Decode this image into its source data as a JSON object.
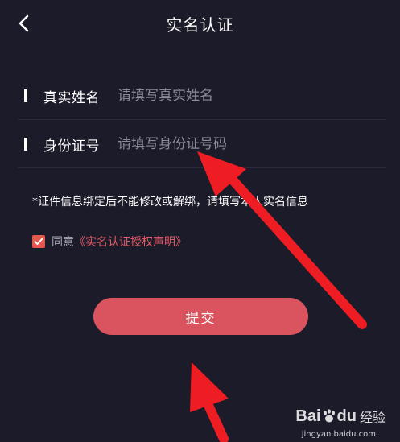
{
  "header": {
    "title": "实名认证",
    "back_icon": "chevron-left-icon"
  },
  "form": {
    "name": {
      "label": "真实姓名",
      "placeholder": "请填写真实姓名",
      "value": ""
    },
    "id_number": {
      "label": "身份证号",
      "placeholder": "请填写身份证号码",
      "value": ""
    }
  },
  "notice": "*证件信息绑定后不能修改或解绑，请填写本人实名信息",
  "agreement": {
    "checked": true,
    "prefix": "同意",
    "link": "《实名认证授权声明》"
  },
  "submit": {
    "label": "提交"
  },
  "watermark": {
    "logo": "Bai",
    "logo2": "du",
    "text": "经验",
    "url": "jingyan.baidu.com"
  },
  "colors": {
    "background": "#1c1b29",
    "accent": "#d9545e",
    "arrow": "#ee1d23"
  }
}
